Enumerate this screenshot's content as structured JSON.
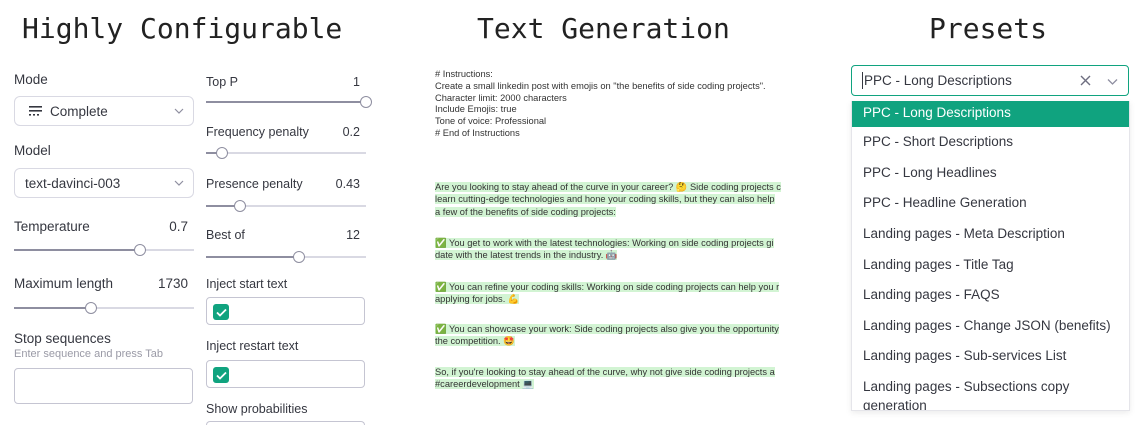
{
  "headings": {
    "configurable": "Highly Configurable",
    "generation": "Text Generation",
    "presets": "Presets"
  },
  "settings": {
    "mode": {
      "label": "Mode",
      "value": "Complete",
      "icon": "mode-complete-icon"
    },
    "model": {
      "label": "Model",
      "value": "text-davinci-003"
    },
    "temperature": {
      "label": "Temperature",
      "value": "0.7",
      "fraction": 0.7
    },
    "maximum_length": {
      "label": "Maximum length",
      "value": "1730",
      "fraction": 0.43
    },
    "stop_sequences": {
      "label": "Stop sequences",
      "hint": "Enter sequence and press Tab"
    },
    "top_p": {
      "label": "Top P",
      "value": "1",
      "fraction": 1.0
    },
    "frequency_penalty": {
      "label": "Frequency penalty",
      "value": "0.2",
      "fraction": 0.1
    },
    "presence_penalty": {
      "label": "Presence penalty",
      "value": "0.43",
      "fraction": 0.215
    },
    "best_of": {
      "label": "Best of",
      "value": "12",
      "fraction": 0.58
    },
    "inject_start": {
      "label": "Inject start text",
      "checked": true
    },
    "inject_restart": {
      "label": "Inject restart text",
      "checked": true
    },
    "show_probabilities": {
      "label": "Show probabilities"
    }
  },
  "generation": {
    "instructions": [
      "# Instructions:",
      "Create a small linkedin post with emojis on \"the benefits of side coding projects\".",
      "Character limit: 2000 characters",
      "Include Emojis: true",
      "Tone of voice: Professional",
      "# End of Instructions"
    ],
    "paragraphs": [
      [
        "Are you looking to stay ahead of the curve in your career? 🤔 Side coding projects c",
        "learn cutting-edge technologies and hone your coding skills, but they can also help",
        " a few of the benefits of side coding projects:"
      ],
      [
        "✅ You get to work with the latest technologies: Working on side coding projects gi",
        "date with the latest trends in the industry. 🤖"
      ],
      [
        "✅ You can refine your coding skills: Working on side coding projects can help you r",
        "applying for jobs. 💪"
      ],
      [
        "✅ You can showcase your work: Side coding projects also give you the opportunity",
        "the competition. 🤩"
      ],
      [
        "So, if you're looking to stay ahead of the curve, why not give side coding projects a",
        "#careerdevelopment 💻"
      ]
    ]
  },
  "presets": {
    "selected": "PPC - Long Descriptions",
    "options": [
      "PPC - Long Descriptions",
      "PPC - Short Descriptions",
      "PPC - Long Headlines",
      "PPC - Headline Generation",
      "Landing pages - Meta Description",
      "Landing pages - Title Tag",
      "Landing pages - FAQS",
      "Landing pages - Change JSON (benefits)",
      "Landing pages - Sub-services List",
      "Landing pages - Subsections copy generation"
    ],
    "accent": "#10a37f"
  }
}
